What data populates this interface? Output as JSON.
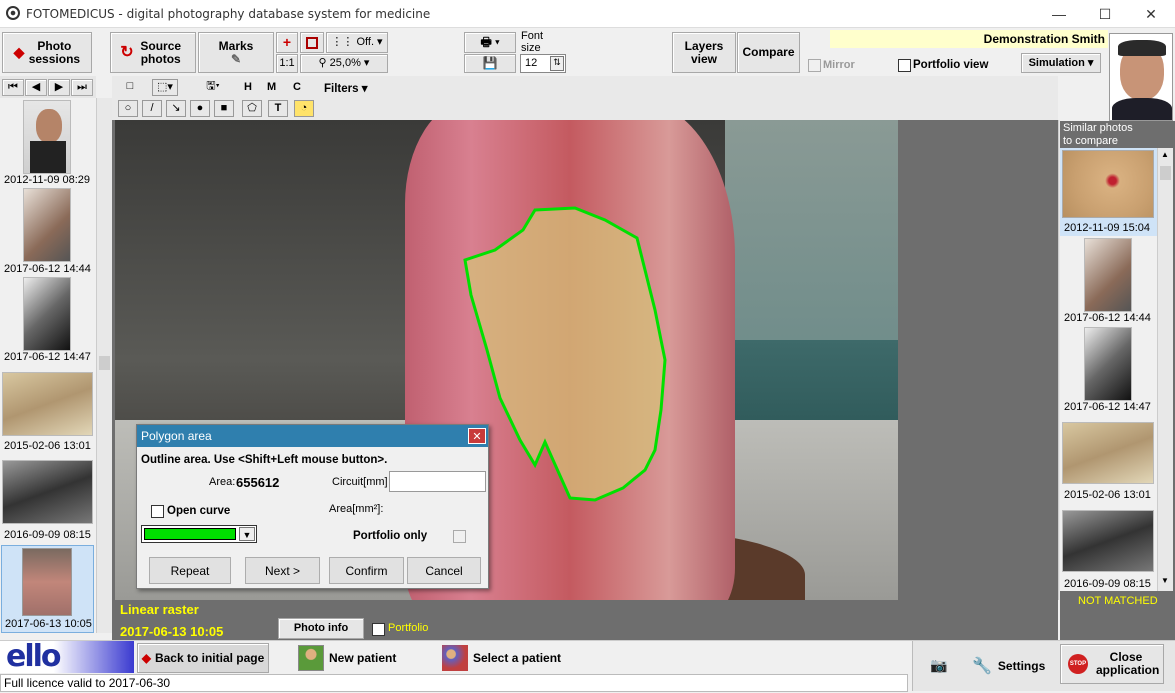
{
  "window": {
    "title": "FOTOMEDICUS - digital photography database system for medicine",
    "min": "—",
    "max": "☐",
    "close": "✕"
  },
  "toolbar": {
    "photo_sessions": "Photo sessions",
    "source_photos": "Source photos",
    "marks": "Marks",
    "one_to_one": "1:1",
    "grid_off": "Off.",
    "zoom": "25,0%",
    "font_size_label": "Font size",
    "font_size": "12",
    "layers_view": "Layers view",
    "compare": "Compare",
    "mirror": "Mirror",
    "portfolio_view": "Portfolio view",
    "simulation": "Simulation",
    "patient_name": "Demonstration Smith"
  },
  "draw_tools": {
    "h": "H",
    "m": "M",
    "c": "C",
    "filters": "Filters",
    "text_tool": "T"
  },
  "left_thumbs": [
    {
      "caption": "2012-11-09 08:29"
    },
    {
      "caption": "2017-06-12 14:44"
    },
    {
      "caption": "2017-06-12 14:47"
    },
    {
      "caption": "2015-02-06 13:01"
    },
    {
      "caption": "2016-09-09 08:15"
    },
    {
      "caption": "2017-06-13 10:05"
    }
  ],
  "right_panel": {
    "similar_label": "Similar photos to compare",
    "not_matched": "NOT MATCHED"
  },
  "right_thumbs": [
    {
      "caption": "2012-11-09 15:04"
    },
    {
      "caption": "2017-06-12 14:44"
    },
    {
      "caption": "2017-06-12 14:47"
    },
    {
      "caption": "2015-02-06 13:01"
    },
    {
      "caption": "2016-09-09 08:15"
    }
  ],
  "photo": {
    "raster": "Linear raster",
    "date": "2017-06-13 10:05",
    "photo_info": "Photo info",
    "portfolio": "Portfolio"
  },
  "dialog": {
    "title": "Polygon area",
    "instruction": "Outline area. Use <Shift+Left mouse button>.",
    "area_label": "Area:",
    "area_value": "655612",
    "circuit_label": "Circuit[mm]",
    "area_mm2_label": "Area[mm²]:",
    "open_curve": "Open curve",
    "portfolio_only": "Portfolio only",
    "repeat": "Repeat",
    "next": "Next >",
    "confirm": "Confirm",
    "cancel": "Cancel",
    "color": "#00e000"
  },
  "bottom": {
    "back": "Back to initial page",
    "new_patient": "New patient",
    "select_patient": "Select a patient",
    "settings": "Settings",
    "close_app": "Close application",
    "licence": "Full licence valid to 2017-06-30",
    "logo": "ello"
  },
  "colors": {
    "accent": "#2f7fae",
    "highlight": "#ffff00",
    "outline": "#00e000",
    "selected_caption": "#cfe3f7"
  }
}
